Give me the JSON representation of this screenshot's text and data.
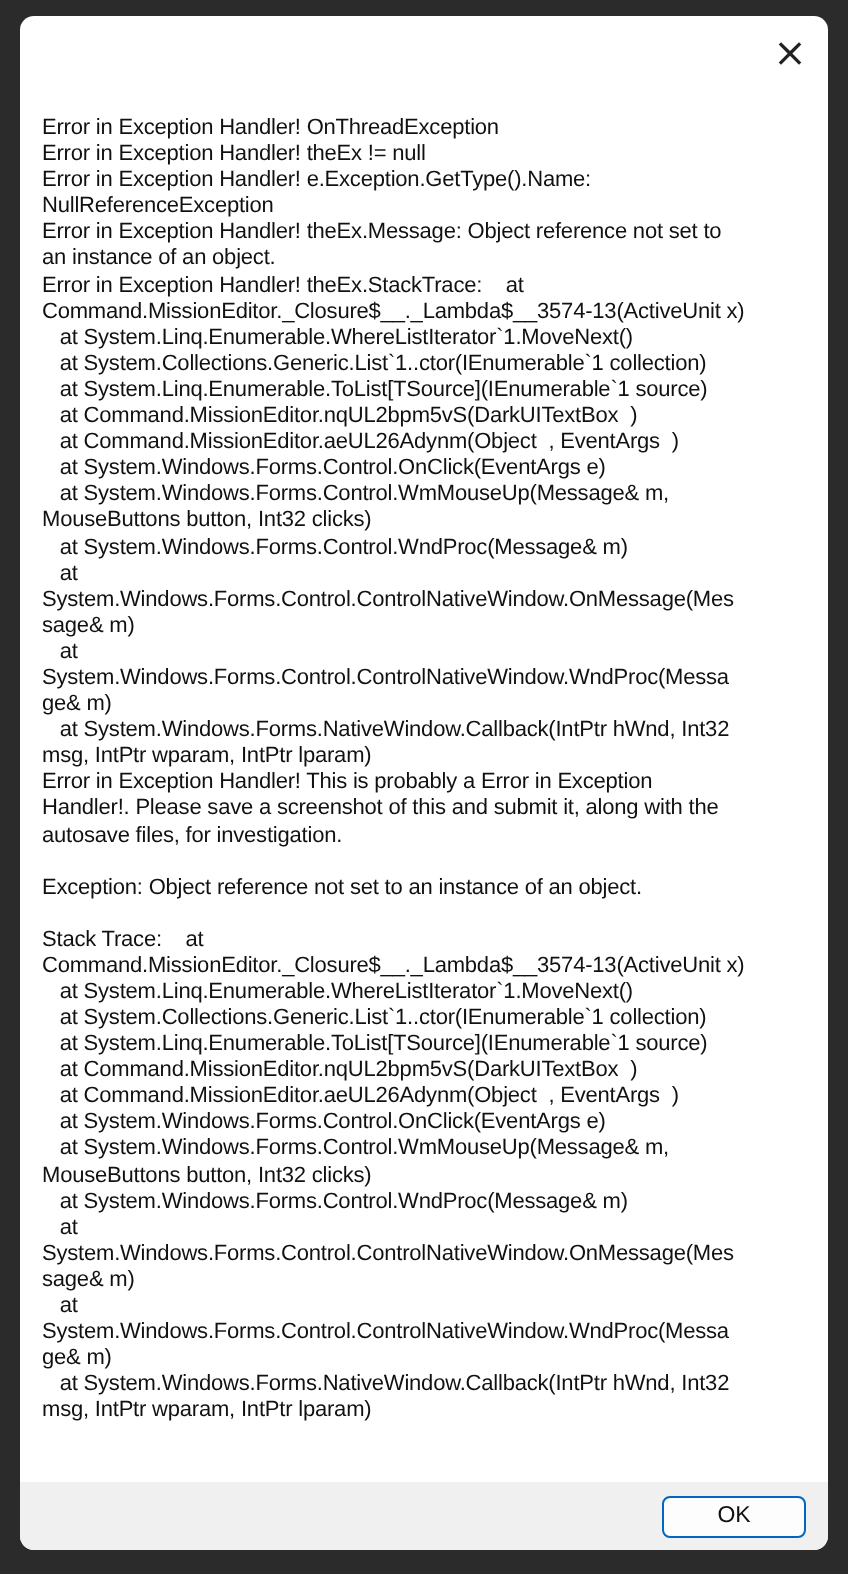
{
  "dialog": {
    "close_label": "×",
    "paragraphs": [
      [
        "Error in Exception Handler! OnThreadException",
        "Error in Exception Handler! theEx != null",
        "Error in Exception Handler! e.Exception.GetType().Name:",
        "NullReferenceException",
        "Error in Exception Handler! theEx.Message: Object reference not set to",
        "an instance of an object.",
        "Error in Exception Handler! theEx.StackTrace:    at",
        "Command.MissionEditor._Closure$__._Lambda$__3574-13(ActiveUnit x)",
        "   at System.Linq.Enumerable.WhereListIterator`1.MoveNext()",
        "   at System.Collections.Generic.List`1..ctor(IEnumerable`1 collection)",
        "   at System.Linq.Enumerable.ToList[TSource](IEnumerable`1 source)",
        "   at Command.MissionEditor.nqUL2bpm5vS(DarkUITextBox  )",
        "   at Command.MissionEditor.aeUL26Adynm(Object  , EventArgs  )",
        "   at System.Windows.Forms.Control.OnClick(EventArgs e)",
        "   at System.Windows.Forms.Control.WmMouseUp(Message& m,",
        "MouseButtons button, Int32 clicks)",
        "   at System.Windows.Forms.Control.WndProc(Message& m)",
        "   at",
        "System.Windows.Forms.Control.ControlNativeWindow.OnMessage(Mes",
        "sage& m)",
        "   at",
        "System.Windows.Forms.Control.ControlNativeWindow.WndProc(Messa",
        "ge& m)",
        "   at System.Windows.Forms.NativeWindow.Callback(IntPtr hWnd, Int32",
        "msg, IntPtr wparam, IntPtr lparam)",
        "Error in Exception Handler! This is probably a Error in Exception",
        "Handler!. Please save a screenshot of this and submit it, along with the",
        "autosave files, for investigation."
      ],
      [
        "Exception: Object reference not set to an instance of an object."
      ],
      [
        "Stack Trace:    at",
        "Command.MissionEditor._Closure$__._Lambda$__3574-13(ActiveUnit x)",
        "   at System.Linq.Enumerable.WhereListIterator`1.MoveNext()",
        "   at System.Collections.Generic.List`1..ctor(IEnumerable`1 collection)",
        "   at System.Linq.Enumerable.ToList[TSource](IEnumerable`1 source)",
        "   at Command.MissionEditor.nqUL2bpm5vS(DarkUITextBox  )",
        "   at Command.MissionEditor.aeUL26Adynm(Object  , EventArgs  )",
        "   at System.Windows.Forms.Control.OnClick(EventArgs e)",
        "   at System.Windows.Forms.Control.WmMouseUp(Message& m,",
        "MouseButtons button, Int32 clicks)",
        "   at System.Windows.Forms.Control.WndProc(Message& m)",
        "   at",
        "System.Windows.Forms.Control.ControlNativeWindow.OnMessage(Mes",
        "sage& m)",
        "   at",
        "System.Windows.Forms.Control.ControlNativeWindow.WndProc(Messa",
        "ge& m)",
        "   at System.Windows.Forms.NativeWindow.Callback(IntPtr hWnd, Int32",
        "msg, IntPtr wparam, IntPtr lparam)"
      ]
    ],
    "buttons": [
      "OK"
    ]
  }
}
